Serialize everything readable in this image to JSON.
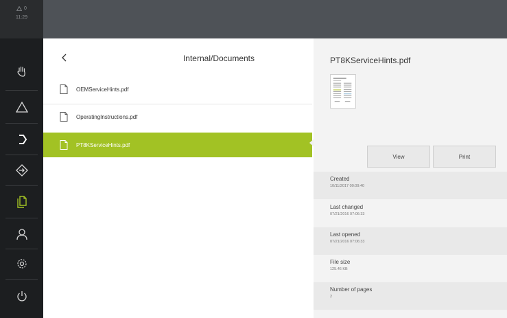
{
  "status": {
    "warning_count": "0",
    "time": "11:29"
  },
  "breadcrumb": {
    "title": "Internal/Documents"
  },
  "files": [
    {
      "name": "OEMServiceHints.pdf"
    },
    {
      "name": "OperatingInstructions.pdf"
    },
    {
      "name": "PT8KServiceHints.pdf"
    }
  ],
  "details": {
    "title": "PT8KServiceHints.pdf",
    "view_label": "View",
    "print_label": "Print",
    "created_label": "Created",
    "created_value": "10/11/2017 00:09:40",
    "changed_label": "Last changed",
    "changed_value": "07/21/2016 07:06:33",
    "opened_label": "Last opened",
    "opened_value": "07/21/2016 07:06:33",
    "size_label": "File size",
    "size_value": "125.46 KB",
    "pages_label": "Number of pages",
    "pages_value": "2"
  },
  "colors": {
    "accent": "#a2c224",
    "sidebar": "#1c1e20",
    "topbar": "#4e5257"
  },
  "nav_icons": [
    "hand-icon",
    "triangle-icon",
    "arrow-right-bracket-icon",
    "diamond-arrow-icon",
    "documents-icon",
    "user-icon",
    "gear-icon",
    "power-icon"
  ]
}
